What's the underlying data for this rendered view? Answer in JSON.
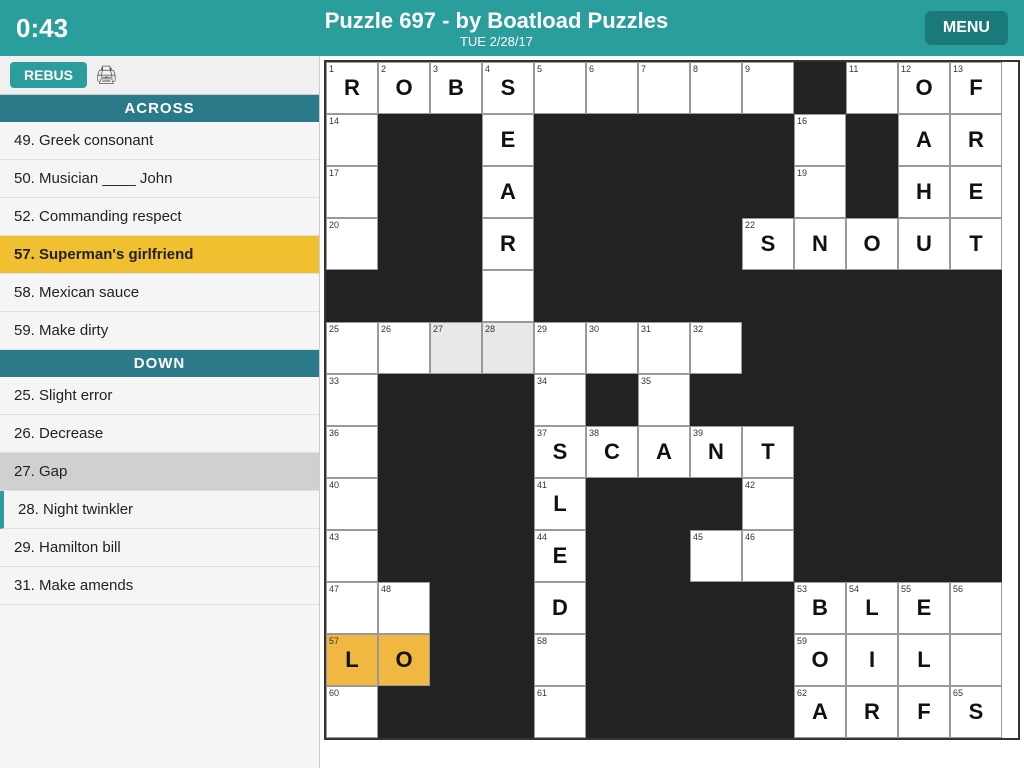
{
  "header": {
    "timer": "0:43",
    "title": "Puzzle 697 - by Boatload Puzzles",
    "date": "TUE 2/28/17",
    "menu_label": "MENU"
  },
  "toolbar": {
    "rebus_label": "REBUS",
    "print_icon": "🖨"
  },
  "sidebar": {
    "across_header": "ACROSS",
    "down_header": "DOWN",
    "across_clues": [
      {
        "number": "49",
        "text": "49. Greek consonant"
      },
      {
        "number": "50",
        "text": "50. Musician ____ John"
      },
      {
        "number": "52",
        "text": "52. Commanding respect"
      },
      {
        "number": "57",
        "text": "57. Superman's girlfriend",
        "active": true
      },
      {
        "number": "58",
        "text": "58. Mexican sauce"
      },
      {
        "number": "59",
        "text": "59. Make dirty"
      }
    ],
    "down_clues": [
      {
        "number": "25",
        "text": "25. Slight error"
      },
      {
        "number": "26",
        "text": "26. Decrease"
      },
      {
        "number": "27",
        "text": "27. Gap",
        "highlighted": true
      },
      {
        "number": "28",
        "text": "28. Night twinkler",
        "teal": true
      },
      {
        "number": "29",
        "text": "29. Hamilton bill"
      },
      {
        "number": "31",
        "text": "31. Make amends"
      }
    ]
  },
  "grid": {
    "cols": 13,
    "rows": 13
  }
}
